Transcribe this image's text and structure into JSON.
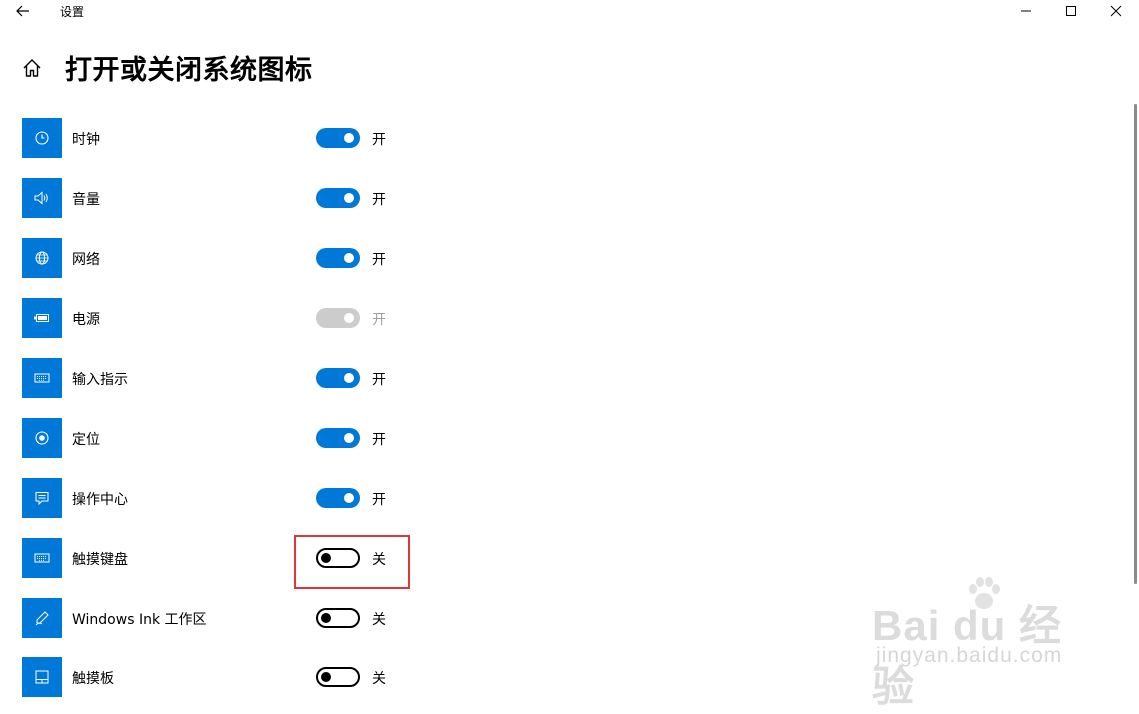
{
  "window": {
    "title": "设置"
  },
  "page": {
    "title": "打开或关闭系统图标"
  },
  "rows": [
    {
      "label": "时钟",
      "state": "开",
      "icon": "clock-icon"
    },
    {
      "label": "音量",
      "state": "开",
      "icon": "volume-icon"
    },
    {
      "label": "网络",
      "state": "开",
      "icon": "network-globe-icon"
    },
    {
      "label": "电源",
      "state": "开",
      "icon": "battery-icon"
    },
    {
      "label": "输入指示",
      "state": "开",
      "icon": "keyboard-icon"
    },
    {
      "label": "定位",
      "state": "开",
      "icon": "location-icon"
    },
    {
      "label": "操作中心",
      "state": "开",
      "icon": "action-center-icon"
    },
    {
      "label": "触摸键盘",
      "state": "关",
      "icon": "touch-keyboard-icon"
    },
    {
      "label": "Windows Ink 工作区",
      "state": "关",
      "icon": "pen-icon"
    },
    {
      "label": "触摸板",
      "state": "关",
      "icon": "touchpad-icon"
    }
  ],
  "colors": {
    "accent": "#0078d7",
    "disabled_toggle": "#cccccc",
    "highlight": "#e0363b"
  },
  "watermark": {
    "main": "Bai du 经验",
    "sub": "jingyan.baidu.com"
  }
}
